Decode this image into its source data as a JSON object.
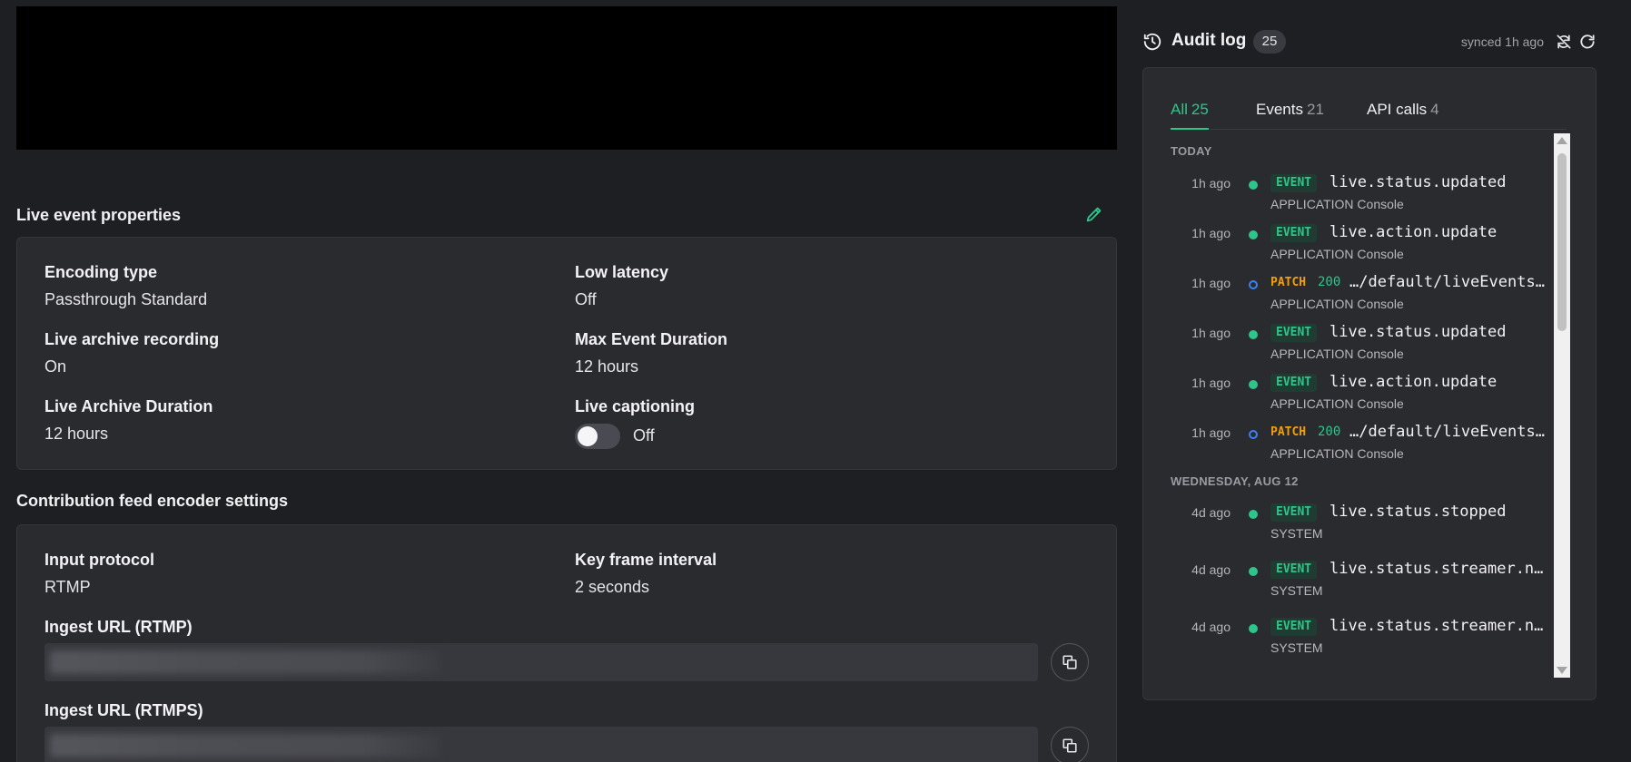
{
  "properties": {
    "title": "Live event properties",
    "edit_icon": "pencil-icon",
    "fields": [
      {
        "label": "Encoding type",
        "value": "Passthrough Standard"
      },
      {
        "label": "Low latency",
        "value": "Off"
      },
      {
        "label": "Live archive recording",
        "value": "On"
      },
      {
        "label": "Max Event Duration",
        "value": "12 hours"
      },
      {
        "label": "Live Archive Duration",
        "value": "12 hours"
      },
      {
        "label": "Live captioning",
        "value": "Off"
      }
    ],
    "captioning_enabled": false
  },
  "encoder": {
    "title": "Contribution feed encoder settings",
    "fields": [
      {
        "label": "Input protocol",
        "value": "RTMP"
      },
      {
        "label": "Key frame interval",
        "value": "2 seconds"
      }
    ],
    "ingest_rtmp_label": "Ingest URL (RTMP)",
    "ingest_rtmps_label": "Ingest URL (RTMPS)",
    "copy_icon": "copy-icon"
  },
  "audit": {
    "title": "Audit log",
    "count": "25",
    "synced": "synced 1h ago",
    "tabs": [
      {
        "label": "All",
        "count": "25",
        "active": true
      },
      {
        "label": "Events",
        "count": "21",
        "active": false
      },
      {
        "label": "API calls",
        "count": "4",
        "active": false
      }
    ],
    "groups": [
      {
        "label": "TODAY"
      },
      {
        "label": "WEDNESDAY, AUG 12"
      }
    ],
    "entries": [
      {
        "time": "1h ago",
        "kind": "EVENT",
        "name": "live.status.updated",
        "source": "APPLICATION Console"
      },
      {
        "time": "1h ago",
        "kind": "EVENT",
        "name": "live.action.update",
        "source": "APPLICATION Console"
      },
      {
        "time": "1h ago",
        "kind": "PATCH",
        "status": "200",
        "name": "…/default/liveEvents/…",
        "source": "APPLICATION Console"
      },
      {
        "time": "1h ago",
        "kind": "EVENT",
        "name": "live.status.updated",
        "source": "APPLICATION Console"
      },
      {
        "time": "1h ago",
        "kind": "EVENT",
        "name": "live.action.update",
        "source": "APPLICATION Console"
      },
      {
        "time": "1h ago",
        "kind": "PATCH",
        "status": "200",
        "name": "…/default/liveEvents/…",
        "source": "APPLICATION Console"
      },
      {
        "time": "4d ago",
        "kind": "EVENT",
        "name": "live.status.stopped",
        "source": "SYSTEM"
      },
      {
        "time": "4d ago",
        "kind": "EVENT",
        "name": "live.status.streamer.no…",
        "source": "SYSTEM"
      },
      {
        "time": "4d ago",
        "kind": "EVENT",
        "name": "live.status.streamer.no…",
        "source": "SYSTEM"
      }
    ]
  },
  "colors": {
    "accent": "#2ec58a",
    "patch": "#f59e0b",
    "patch_dot": "#3b82f6",
    "background": "#1e1f22",
    "card": "#2a2b2f"
  }
}
